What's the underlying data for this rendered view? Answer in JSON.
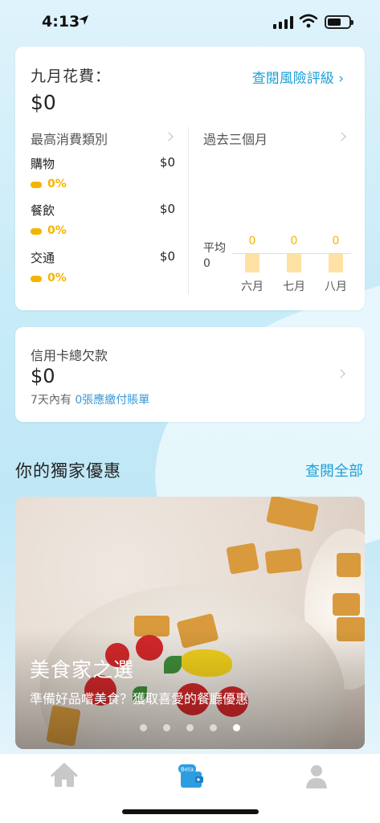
{
  "status_bar": {
    "time": "4:13"
  },
  "spending_card": {
    "month_label": "九月花費：",
    "amount": "$0",
    "risk_link": "查閱風險評級 ›",
    "top_categories_title": "最高消費類別",
    "categories": [
      {
        "name": "購物",
        "value": "$0",
        "percent": "0%"
      },
      {
        "name": "餐飲",
        "value": "$0",
        "percent": "0%"
      },
      {
        "name": "交通",
        "value": "$0",
        "percent": "0%"
      }
    ],
    "past_months_title": "過去三個月",
    "average_label": "平均",
    "average_value": "0"
  },
  "chart_data": {
    "type": "bar",
    "categories": [
      "六月",
      "七月",
      "八月"
    ],
    "values": [
      0,
      0,
      0
    ],
    "value_labels": [
      "0",
      "0",
      "0"
    ]
  },
  "credit_card": {
    "title": "信用卡總欠款",
    "amount": "$0",
    "subtitle_prefix": "7天內有",
    "subtitle_link": "0張應繳付賬單"
  },
  "offers": {
    "section_title": "你的獨家優惠",
    "see_all": "查閱全部",
    "promo_title": "美食家之選",
    "promo_subtitle": "準備好品嚐美食？獲取喜愛的餐廳優惠",
    "carousel_pages": 5,
    "active_page": 5
  },
  "tabbar": {
    "tabs": [
      {
        "icon": "home-icon"
      },
      {
        "icon": "wallet-icon",
        "badge": "Beta"
      },
      {
        "icon": "profile-icon"
      }
    ]
  },
  "colors": {
    "accent": "#1ea0d8",
    "warning": "#f5b400",
    "bar_fill": "#fde2a4"
  }
}
